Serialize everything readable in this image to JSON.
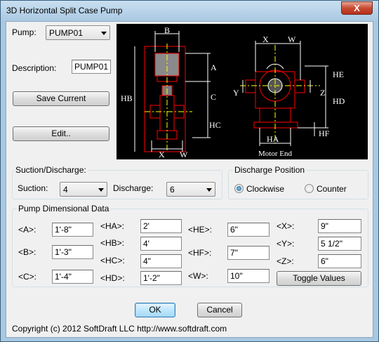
{
  "window": {
    "title": "3D Horizontal Split Case Pump",
    "close_glyph": "X"
  },
  "pump_section": {
    "pump_label": "Pump:",
    "pump_value": "PUMP01",
    "description_label": "Description:",
    "description_value": "PUMP01",
    "save_button": "Save Current",
    "edit_button": "Edit.."
  },
  "diagram": {
    "labels": {
      "hb": "HB",
      "b": "B",
      "a": "A",
      "c": "C",
      "hc": "HC",
      "x_left": "X",
      "w_left": "W",
      "x_right": "X",
      "w_right": "W",
      "y": "Y",
      "z": "Z",
      "he": "HE",
      "hd": "HD",
      "hf": "HF",
      "ha": "HA",
      "motor_end": "Motor End"
    },
    "colors": {
      "background": "#000000",
      "outline": "#ff0000",
      "dimension": "#ffffff",
      "centerline": "#ffff00",
      "body": "#9a9a9a"
    }
  },
  "suction_discharge": {
    "title": "Suction/Discharge:",
    "suction_label": "Suction:",
    "suction_value": "4",
    "discharge_label": "Discharge:",
    "discharge_value": "6"
  },
  "discharge_position": {
    "title": "Discharge Position",
    "options": [
      {
        "label": "Clockwise",
        "selected": true
      },
      {
        "label": "Counter",
        "selected": false
      }
    ]
  },
  "dimensional_data": {
    "title": "Pump Dimensional Data",
    "fields": {
      "a": {
        "label": "<A>:",
        "value": "1'-8\""
      },
      "b": {
        "label": "<B>:",
        "value": "1'-3\""
      },
      "c": {
        "label": "<C>:",
        "value": "1'-4\""
      },
      "ha": {
        "label": "<HA>:",
        "value": "2'"
      },
      "hb": {
        "label": "<HB>:",
        "value": "4'"
      },
      "hc": {
        "label": "<HC>:",
        "value": "4\""
      },
      "hd": {
        "label": "<HD>:",
        "value": "1'-2\""
      },
      "he": {
        "label": "<HE>:",
        "value": "6\""
      },
      "hf": {
        "label": "<HF>:",
        "value": "7\""
      },
      "w": {
        "label": "<W>:",
        "value": "10\""
      },
      "x": {
        "label": "<X>:",
        "value": "9\""
      },
      "y": {
        "label": "<Y>:",
        "value": "5 1/2\""
      },
      "z": {
        "label": "<Z>:",
        "value": "6\""
      }
    },
    "toggle_button": "Toggle Values"
  },
  "footer": {
    "ok": "OK",
    "cancel": "Cancel",
    "copyright": "Copyright (c) 2012 SoftDraft LLC   http://www.softdraft.com"
  }
}
